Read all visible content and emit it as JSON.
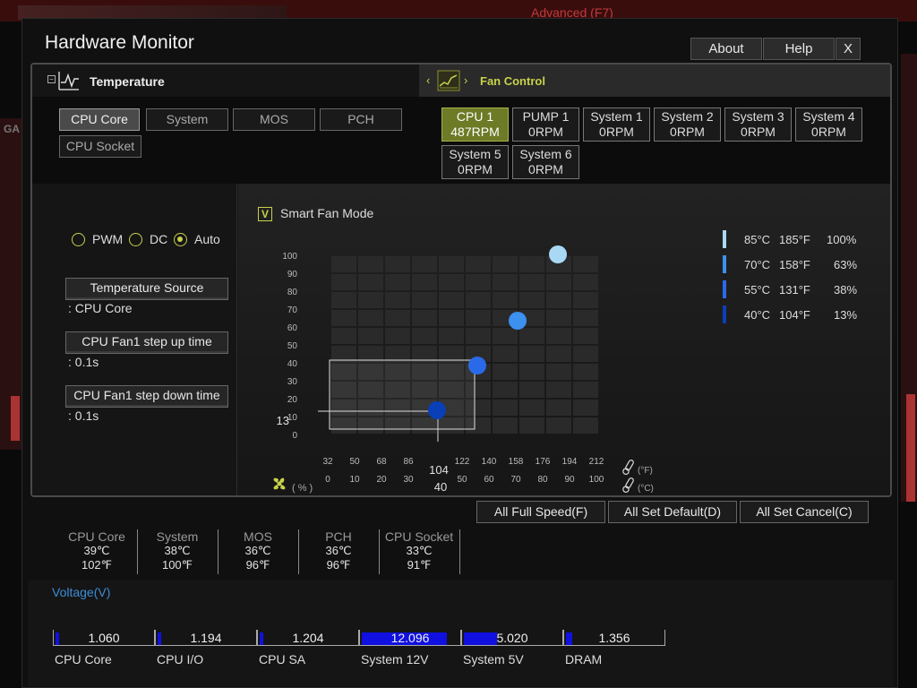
{
  "background": {
    "advanced_label": "Advanced (F7)",
    "left_tab": "GA"
  },
  "window": {
    "title": "Hardware Monitor",
    "buttons": [
      "About",
      "Help",
      "X"
    ]
  },
  "tabs": {
    "temperature": "Temperature",
    "fan_control": "Fan Control"
  },
  "sensors": [
    "CPU Core",
    "System",
    "MOS",
    "PCH",
    "CPU Socket"
  ],
  "fans": [
    {
      "name": "CPU 1",
      "rpm": "487RPM",
      "active": true
    },
    {
      "name": "PUMP 1",
      "rpm": "0RPM"
    },
    {
      "name": "System 1",
      "rpm": "0RPM"
    },
    {
      "name": "System 2",
      "rpm": "0RPM"
    },
    {
      "name": "System 3",
      "rpm": "0RPM"
    },
    {
      "name": "System 4",
      "rpm": "0RPM"
    },
    {
      "name": "System 5",
      "rpm": "0RPM"
    },
    {
      "name": "System 6",
      "rpm": "0RPM"
    }
  ],
  "mode": {
    "pwm": "PWM",
    "dc": "DC",
    "auto": "Auto",
    "selected": "Auto"
  },
  "settings": {
    "temp_source_label": "Temperature Source",
    "temp_source_value": ": CPU Core",
    "step_up_label": "CPU Fan1 step up time",
    "step_up_value": ": 0.1s",
    "step_down_label": "CPU Fan1 step down time",
    "step_down_value": ": 0.1s"
  },
  "smart_fan": {
    "label": "Smart Fan Mode",
    "checked": true,
    "check_glyph": "V"
  },
  "chart_data": {
    "type": "scatter",
    "title": "",
    "ylabel": "( % )",
    "ylim": [
      0,
      100
    ],
    "y_ticks": [
      "100",
      "90",
      "80",
      "70",
      "60",
      "50",
      "40",
      "30",
      "20",
      "10",
      "0"
    ],
    "x_ticks_f": [
      "32",
      "50",
      "68",
      "86",
      "104",
      "122",
      "140",
      "158",
      "176",
      "194",
      "212"
    ],
    "x_ticks_c": [
      "0",
      "10",
      "20",
      "30",
      "40",
      "50",
      "60",
      "70",
      "80",
      "90",
      "100"
    ],
    "unit_f": "(°F)",
    "unit_c": "(°C)",
    "points": [
      {
        "temp_c": 40,
        "fan_pct": 13,
        "color": "#0a3fb8"
      },
      {
        "temp_c": 55,
        "fan_pct": 38,
        "color": "#2a6ae8"
      },
      {
        "temp_c": 70,
        "fan_pct": 63,
        "color": "#3c90ee"
      },
      {
        "temp_c": 85,
        "fan_pct": 100,
        "color": "#a9d8f5"
      }
    ],
    "selected_point": {
      "y_readout": "13",
      "x_readout_f": "104",
      "x_readout_c": "40"
    }
  },
  "legend": [
    {
      "c": "85°C",
      "f": "185°F",
      "pct": "100%",
      "color": "#a9d8f5"
    },
    {
      "c": "70°C",
      "f": "158°F",
      "pct": "63%",
      "color": "#3c90ee"
    },
    {
      "c": "55°C",
      "f": "131°F",
      "pct": "38%",
      "color": "#2a6ae8"
    },
    {
      "c": "40°C",
      "f": "104°F",
      "pct": "13%",
      "color": "#0a3fb8"
    }
  ],
  "actions": [
    "All Full Speed(F)",
    "All Set Default(D)",
    "All Set Cancel(C)"
  ],
  "temperatures": [
    {
      "name": "CPU Core",
      "c": "39℃",
      "f": "102℉"
    },
    {
      "name": "System",
      "c": "38℃",
      "f": "100℉"
    },
    {
      "name": "MOS",
      "c": "36℃",
      "f": "96℉"
    },
    {
      "name": "PCH",
      "c": "36℃",
      "f": "96℉"
    },
    {
      "name": "CPU Socket",
      "c": "33℃",
      "f": "91℉"
    }
  ],
  "voltage": {
    "title": "Voltage(V)",
    "items": [
      {
        "name": "CPU Core",
        "value": "1.060",
        "fill": 0.04
      },
      {
        "name": "CPU I/O",
        "value": "1.194",
        "fill": 0.04
      },
      {
        "name": "CPU SA",
        "value": "1.204",
        "fill": 0.04
      },
      {
        "name": "System 12V",
        "value": "12.096",
        "fill": 0.86
      },
      {
        "name": "System 5V",
        "value": "5.020",
        "fill": 0.34
      },
      {
        "name": "DRAM",
        "value": "1.356",
        "fill": 0.06
      }
    ]
  }
}
